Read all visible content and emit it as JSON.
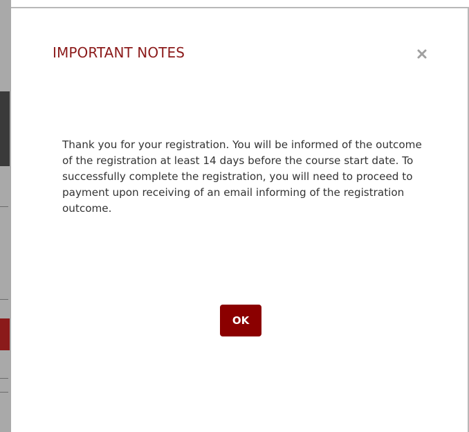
{
  "modal": {
    "title": "IMPORTANT NOTES",
    "close_icon": "close-icon",
    "message": "Thank you for your registration. You will be informed of the outcome of the registration at least 14 days before the course start date. To successfully complete the registration, you will need to proceed to payment upon receiving of an email informing of the registration outcome.",
    "ok_label": "OK"
  },
  "colors": {
    "accent": "#8b1a1a",
    "button_bg": "#8b0000",
    "body_text": "#333333",
    "close_icon": "#a0a0a0"
  }
}
